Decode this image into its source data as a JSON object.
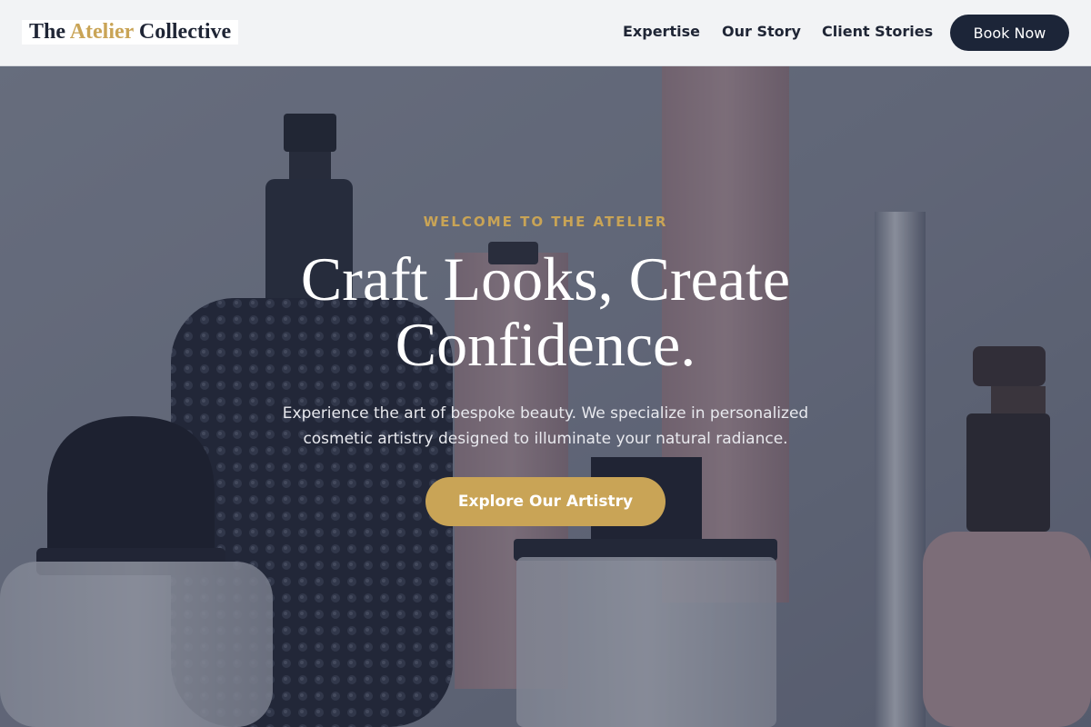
{
  "header": {
    "logo": {
      "part1": "The",
      "part2": "Atelier",
      "part3": "Collective"
    },
    "nav": [
      {
        "label": "Expertise"
      },
      {
        "label": "Our Story"
      },
      {
        "label": "Client Stories"
      }
    ],
    "cta_label": "Book Now"
  },
  "hero": {
    "eyebrow": "WELCOME TO THE ATELIER",
    "headline": "Craft Looks, Create Confidence.",
    "subtext": "Experience the art of bespoke beauty. We specialize in personalized cosmetic artistry designed to illuminate your natural radiance.",
    "cta_label": "Explore Our Artistry"
  },
  "colors": {
    "accent_gold": "#c9a456",
    "navy": "#1c2538",
    "header_bg": "#f2f3f5"
  }
}
